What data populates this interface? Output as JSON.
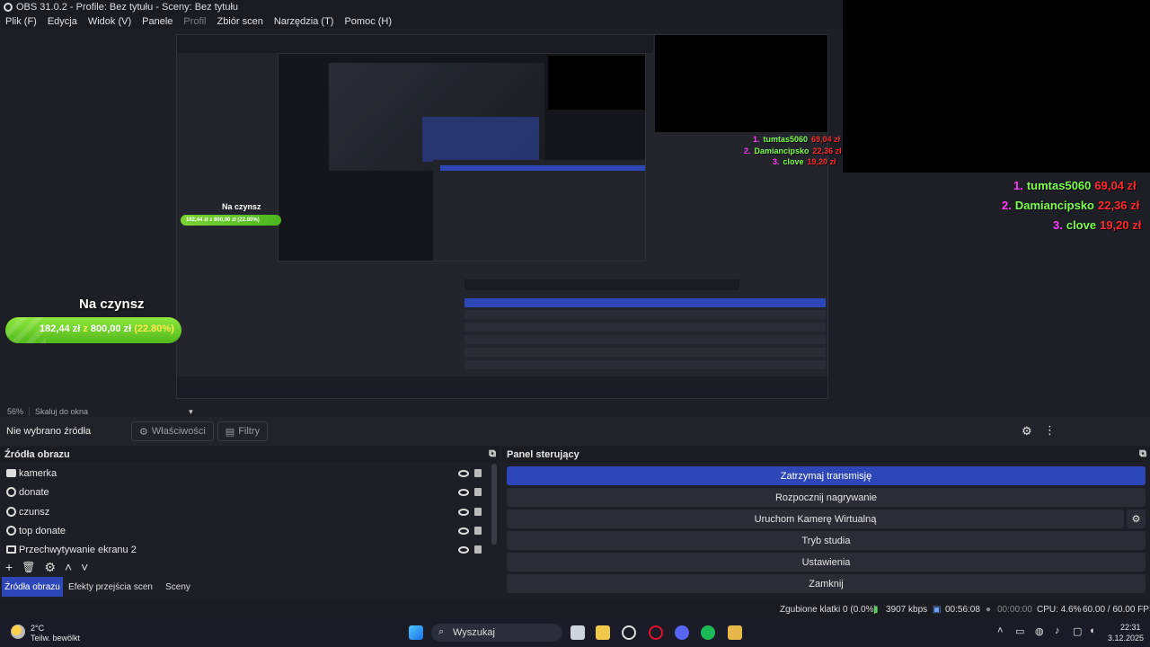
{
  "window": {
    "title": "OBS 31.0.2 - Profile: Bez tytułu - Sceny: Bez tytułu"
  },
  "menu": [
    "Plik (F)",
    "Edycja",
    "Widok (V)",
    "Panele",
    "Profil",
    "Zbiór scen",
    "Narzędzia (T)",
    "Pomoc (H)"
  ],
  "ranking": [
    {
      "num": "1.",
      "name": "tumtas5060",
      "amount": "69,04 zł"
    },
    {
      "num": "2.",
      "name": "Damiancipsko",
      "amount": "22,36 zł"
    },
    {
      "num": "3.",
      "name": "clove",
      "amount": "19,20 zł"
    }
  ],
  "rent": {
    "title": "Na czynsz",
    "amount": "182,44 zł",
    "of": "z",
    "goal": "800,00 zł",
    "percent": "(22.80%)",
    "progress": 0.228
  },
  "preview_bar": {
    "zoom": "56%",
    "scale_mode": "Skaluj do okna"
  },
  "props": {
    "no_source": "Nie wybrano źródła",
    "properties": "Właściwości",
    "filters": "Filtry"
  },
  "sources": {
    "title": "Źródła obrazu",
    "items": [
      {
        "label": "kamerka",
        "icon": "camera-icon"
      },
      {
        "label": "donate",
        "icon": "globe-icon"
      },
      {
        "label": "czunsz",
        "icon": "globe-icon"
      },
      {
        "label": "top donate",
        "icon": "globe-icon"
      },
      {
        "label": "Przechwytywanie ekranu 2",
        "icon": "monitor-icon"
      }
    ]
  },
  "tabs": [
    "Źródła obrazu",
    "Efekty przejścia scen",
    "Sceny"
  ],
  "controls": {
    "title": "Panel sterujący",
    "buttons": [
      "Zatrzymaj transmisję",
      "Rozpocznij nagrywanie",
      "Uruchom Kamerę Wirtualną",
      "Tryb studia",
      "Ustawienia",
      "Zamknij"
    ]
  },
  "status": {
    "dropped": "Zgubione klatki 0 (0.0%)",
    "bitrate": "3907 kbps",
    "stream_time": "00:56:08",
    "rec_time": "00:00:00",
    "cpu": "CPU: 4.6%",
    "fps": "60.00 / 60.00 FPS"
  },
  "taskbar": {
    "weather_temp": "2°C",
    "weather_desc": "Teilw. bewölkt",
    "search": "Wyszukaj",
    "time": "22:31",
    "date": "3.12.2025"
  },
  "nested": {
    "rent_title": "Na czynsz",
    "rent_text": "182,44 zł z 800,00 zł (22.80%)"
  },
  "colors": {
    "accent": "#2d47b8",
    "rank_num": "#ff3cff",
    "rank_name": "#7cff4c",
    "rank_amount": "#ff2a2a"
  }
}
